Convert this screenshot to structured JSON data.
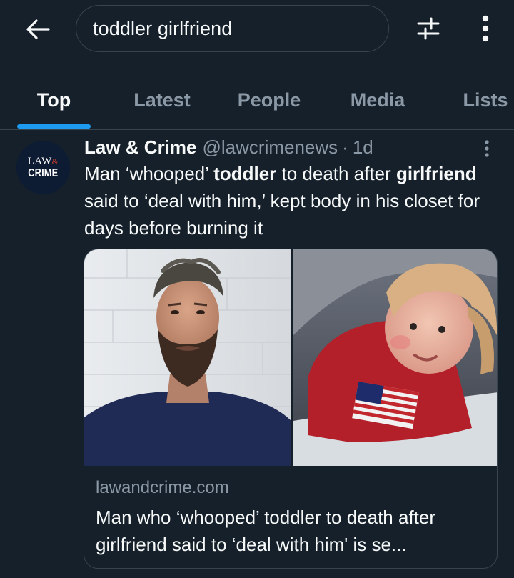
{
  "search": {
    "query": "toddler girlfriend"
  },
  "icons": {
    "back": "arrow-left-icon",
    "filter": "sliders-icon",
    "more": "vertical-ellipsis-icon"
  },
  "tabs": [
    {
      "label": "Top",
      "active": true
    },
    {
      "label": "Latest",
      "active": false
    },
    {
      "label": "People",
      "active": false
    },
    {
      "label": "Media",
      "active": false
    },
    {
      "label": "Lists",
      "active": false
    }
  ],
  "colors": {
    "background": "#15202b",
    "accent": "#1d9bf0",
    "text_primary": "#f7f9f9",
    "text_secondary": "#8b98a5",
    "border": "#38444d"
  },
  "tweet": {
    "author_name": "Law & Crime",
    "author_handle": "@lawcrimenews",
    "separator": "·",
    "time": "1d",
    "avatar": {
      "line1": "LAW",
      "amp": "&",
      "line2": "CRIME"
    },
    "text_parts": [
      {
        "text": "Man ‘whooped’ ",
        "bold": false
      },
      {
        "text": "toddler",
        "bold": true
      },
      {
        "text": " to death after ",
        "bold": false
      },
      {
        "text": "girlfriend",
        "bold": true
      },
      {
        "text": " said to ‘deal with him,’ kept body in his closet for days before burning it",
        "bold": false
      }
    ],
    "card": {
      "domain": "lawandcrime.com",
      "title": "Man who ‘whooped’ toddler to death after girlfriend said to ‘deal with him' is se..."
    }
  }
}
